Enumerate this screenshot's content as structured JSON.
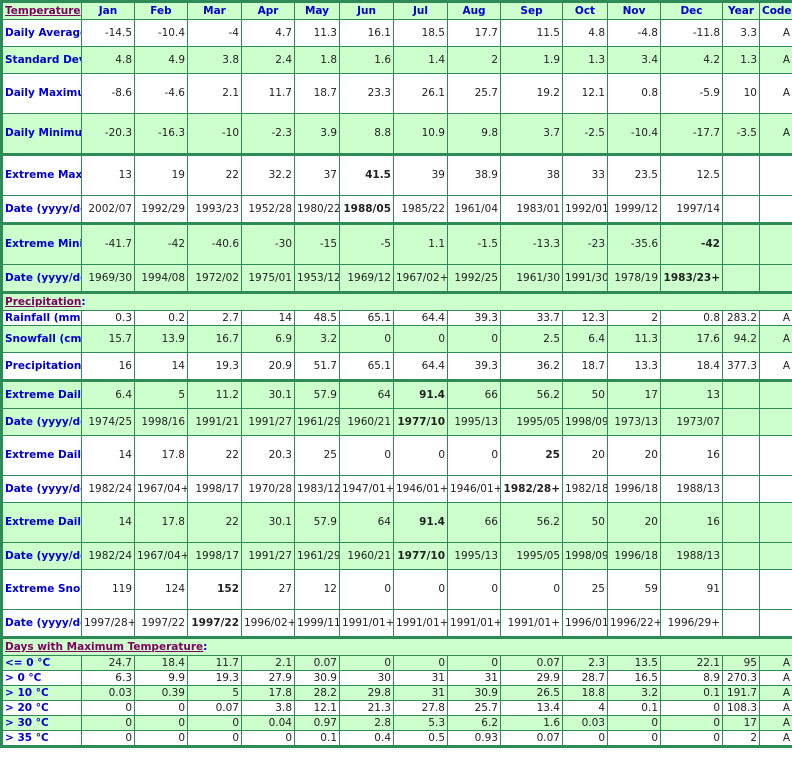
{
  "header": {
    "section_label": "Temperature",
    "months": [
      "Jan",
      "Feb",
      "Mar",
      "Apr",
      "May",
      "Jun",
      "Jul",
      "Aug",
      "Sep",
      "Oct",
      "Nov",
      "Dec"
    ],
    "year_label": "Year",
    "code_label": "Code"
  },
  "sections": [
    {
      "title": "Temperature",
      "show_header": true,
      "rows": [
        {
          "label": "Daily Average (°C)",
          "values": [
            "-14.5",
            "-10.4",
            "-4",
            "4.7",
            "11.3",
            "16.1",
            "18.5",
            "17.7",
            "11.5",
            "4.8",
            "-4.8",
            "-11.8"
          ],
          "year": "3.3",
          "code": "A",
          "bold": []
        },
        {
          "label": "Standard Deviation",
          "values": [
            "4.8",
            "4.9",
            "3.8",
            "2.4",
            "1.8",
            "1.6",
            "1.4",
            "2",
            "1.9",
            "1.3",
            "3.4",
            "4.2"
          ],
          "year": "1.3",
          "code": "A",
          "bold": []
        },
        {
          "label": "Daily Maximum (°C)",
          "values": [
            "-8.6",
            "-4.6",
            "2.1",
            "11.7",
            "18.7",
            "23.3",
            "26.1",
            "25.7",
            "19.2",
            "12.1",
            "0.8",
            "-5.9"
          ],
          "year": "10",
          "code": "A",
          "bold": []
        },
        {
          "label": "Daily Minimum (°C)",
          "values": [
            "-20.3",
            "-16.3",
            "-10",
            "-2.3",
            "3.9",
            "8.8",
            "10.9",
            "9.8",
            "3.7",
            "-2.5",
            "-10.4",
            "-17.7"
          ],
          "year": "-3.5",
          "code": "A",
          "bold": []
        },
        {
          "label": "Extreme Maximum (°C)",
          "values": [
            "13",
            "19",
            "22",
            "32.2",
            "37",
            "41.5",
            "39",
            "38.9",
            "38",
            "33",
            "23.5",
            "12.5"
          ],
          "year": "",
          "code": "",
          "bold": [
            5
          ]
        },
        {
          "label": "Date (yyyy/dd)",
          "values": [
            "2002/07",
            "1992/29",
            "1993/23",
            "1952/28",
            "1980/22",
            "1988/05",
            "1985/22",
            "1961/04",
            "1983/01",
            "1992/01",
            "1999/12",
            "1997/14"
          ],
          "year": "",
          "code": "",
          "bold": [
            5
          ]
        },
        {
          "label": "Extreme Minimum (°C)",
          "values": [
            "-41.7",
            "-42",
            "-40.6",
            "-30",
            "-15",
            "-5",
            "1.1",
            "-1.5",
            "-13.3",
            "-23",
            "-35.6",
            "-42"
          ],
          "year": "",
          "code": "",
          "bold": [
            11
          ]
        },
        {
          "label": "Date (yyyy/dd)",
          "values": [
            "1969/30",
            "1994/08",
            "1972/02",
            "1975/01",
            "1953/12",
            "1969/12",
            "1967/02+",
            "1992/25",
            "1961/30",
            "1991/30",
            "1978/19",
            "1983/23+"
          ],
          "year": "",
          "code": "",
          "bold": [
            11
          ]
        }
      ]
    },
    {
      "title": "Precipitation",
      "rows": [
        {
          "label": "Rainfall (mm)",
          "values": [
            "0.3",
            "0.2",
            "2.7",
            "14",
            "48.5",
            "65.1",
            "64.4",
            "39.3",
            "33.7",
            "12.3",
            "2",
            "0.8"
          ],
          "year": "283.2",
          "code": "A",
          "bold": []
        },
        {
          "label": "Snowfall (cm)",
          "values": [
            "15.7",
            "13.9",
            "16.7",
            "6.9",
            "3.2",
            "0",
            "0",
            "0",
            "2.5",
            "6.4",
            "11.3",
            "17.6"
          ],
          "year": "94.2",
          "code": "A",
          "bold": []
        },
        {
          "label": "Precipitation (mm)",
          "values": [
            "16",
            "14",
            "19.3",
            "20.9",
            "51.7",
            "65.1",
            "64.4",
            "39.3",
            "36.2",
            "18.7",
            "13.3",
            "18.4"
          ],
          "year": "377.3",
          "code": "A",
          "bold": []
        },
        {
          "label": "Extreme Daily Rainfall (mm)",
          "values": [
            "6.4",
            "5",
            "11.2",
            "30.1",
            "57.9",
            "64",
            "91.4",
            "66",
            "56.2",
            "50",
            "17",
            "13"
          ],
          "year": "",
          "code": "",
          "bold": [
            6
          ]
        },
        {
          "label": "Date (yyyy/dd)",
          "values": [
            "1974/25",
            "1998/16",
            "1991/21",
            "1991/27",
            "1961/29",
            "1960/21",
            "1977/10",
            "1995/13",
            "1995/05",
            "1998/09",
            "1973/13",
            "1973/07"
          ],
          "year": "",
          "code": "",
          "bold": [
            6
          ]
        },
        {
          "label": "Extreme Daily Snowfall (cm)",
          "values": [
            "14",
            "17.8",
            "22",
            "20.3",
            "25",
            "0",
            "0",
            "0",
            "25",
            "20",
            "20",
            "16"
          ],
          "year": "",
          "code": "",
          "bold": [
            8
          ]
        },
        {
          "label": "Date (yyyy/dd)",
          "values": [
            "1982/24",
            "1967/04+",
            "1998/17",
            "1970/28",
            "1983/12",
            "1947/01+",
            "1946/01+",
            "1946/01+",
            "1982/28+",
            "1982/18",
            "1996/18",
            "1988/13"
          ],
          "year": "",
          "code": "",
          "bold": [
            8
          ]
        },
        {
          "label": "Extreme Daily Precipitation (mm)",
          "values": [
            "14",
            "17.8",
            "22",
            "30.1",
            "57.9",
            "64",
            "91.4",
            "66",
            "56.2",
            "50",
            "20",
            "16"
          ],
          "year": "",
          "code": "",
          "bold": [
            6
          ]
        },
        {
          "label": "Date (yyyy/dd)",
          "values": [
            "1982/24",
            "1967/04+",
            "1998/17",
            "1991/27",
            "1961/29",
            "1960/21",
            "1977/10",
            "1995/13",
            "1995/05",
            "1998/09",
            "1996/18",
            "1988/13"
          ],
          "year": "",
          "code": "",
          "bold": [
            6
          ]
        },
        {
          "label": "Extreme Snow Depth (cm)",
          "values": [
            "119",
            "124",
            "152",
            "27",
            "12",
            "0",
            "0",
            "0",
            "0",
            "25",
            "59",
            "91"
          ],
          "year": "",
          "code": "",
          "bold": [
            2
          ]
        },
        {
          "label": "Date (yyyy/dd)",
          "values": [
            "1997/28+",
            "1997/22",
            "1997/22",
            "1996/02+",
            "1999/11",
            "1991/01+",
            "1991/01+",
            "1991/01+",
            "1991/01+",
            "1996/01",
            "1996/22+",
            "1996/29+"
          ],
          "year": "",
          "code": "",
          "bold": [
            2
          ]
        }
      ]
    },
    {
      "title": "Days with Maximum Temperature",
      "rows": [
        {
          "label": "<= 0 °C",
          "values": [
            "24.7",
            "18.4",
            "11.7",
            "2.1",
            "0.07",
            "0",
            "0",
            "0",
            "0.07",
            "2.3",
            "13.5",
            "22.1"
          ],
          "year": "95",
          "code": "A",
          "bold": []
        },
        {
          "label": "> 0 °C",
          "values": [
            "6.3",
            "9.9",
            "19.3",
            "27.9",
            "30.9",
            "30",
            "31",
            "31",
            "29.9",
            "28.7",
            "16.5",
            "8.9"
          ],
          "year": "270.3",
          "code": "A",
          "bold": []
        },
        {
          "label": "> 10 °C",
          "values": [
            "0.03",
            "0.39",
            "5",
            "17.8",
            "28.2",
            "29.8",
            "31",
            "30.9",
            "26.5",
            "18.8",
            "3.2",
            "0.1"
          ],
          "year": "191.7",
          "code": "A",
          "bold": []
        },
        {
          "label": "> 20 °C",
          "values": [
            "0",
            "0",
            "0.07",
            "3.8",
            "12.1",
            "21.3",
            "27.8",
            "25.7",
            "13.4",
            "4",
            "0.1",
            "0"
          ],
          "year": "108.3",
          "code": "A",
          "bold": []
        },
        {
          "label": "> 30 °C",
          "values": [
            "0",
            "0",
            "0",
            "0.04",
            "0.97",
            "2.8",
            "5.3",
            "6.2",
            "1.6",
            "0.03",
            "0",
            "0"
          ],
          "year": "17",
          "code": "A",
          "bold": []
        },
        {
          "label": "> 35 °C",
          "values": [
            "0",
            "0",
            "0",
            "0",
            "0.1",
            "0.4",
            "0.5",
            "0.93",
            "0.07",
            "0",
            "0",
            "0"
          ],
          "year": "2",
          "code": "A",
          "bold": []
        }
      ]
    }
  ]
}
